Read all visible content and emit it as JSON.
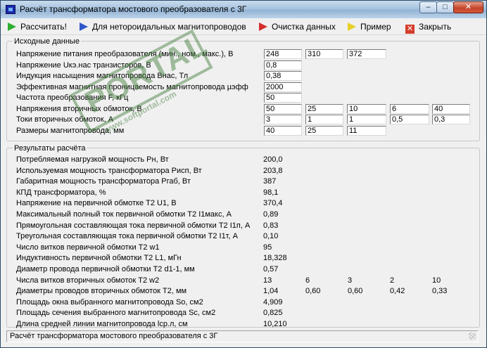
{
  "window": {
    "title": "Расчёт трансформатора мостового преобразователя с 3Г",
    "minimize_glyph": "–",
    "maximize_glyph": "□",
    "close_glyph": "✕"
  },
  "menu": [
    {
      "label": "Рассчитать!",
      "icon": "green-arrow-icon"
    },
    {
      "label": "Для нетороидальных магнитопроводов",
      "icon": "blue-arrow-icon"
    },
    {
      "label": "Очистка данных",
      "icon": "red-arrow-icon"
    },
    {
      "label": "Пример",
      "icon": "yellow-arrow-icon"
    },
    {
      "label": "Закрыть",
      "icon": "close-x-icon"
    }
  ],
  "input_group": {
    "title": "Исходные данные",
    "rows": [
      {
        "label": "Напряжение питания преобразователя (мин., ном., макс.), В",
        "values": [
          "248",
          "310",
          "372"
        ]
      },
      {
        "label": "Напряжение Uкэ.нас транзисторов, В",
        "values": [
          "0,8"
        ]
      },
      {
        "label": "Индукция насыщения магнитопровода Bнас, Тл",
        "values": [
          "0,38"
        ]
      },
      {
        "label": "Эффективная магнитная проницаемость магнитопровода µэфф",
        "values": [
          "2000"
        ]
      },
      {
        "label": "Частота преобразования F, кГц",
        "values": [
          "50"
        ]
      },
      {
        "label": "Напряжения вторичных обмоток, В",
        "values": [
          "50",
          "25",
          "10",
          "6",
          "40"
        ]
      },
      {
        "label": "Токи вторичных обмоток, А",
        "values": [
          "3",
          "1",
          "1",
          "0,5",
          "0,3"
        ]
      },
      {
        "label": "Размеры магнитопровода, мм",
        "values": [
          "40",
          "25",
          "11"
        ]
      }
    ]
  },
  "results_group": {
    "title": "Результаты расчёта",
    "rows": [
      {
        "label": "Потребляемая нагрузкой мощность Рн, Вт",
        "values": [
          "200,0"
        ]
      },
      {
        "label": "Используемая мощность трансформатора Рисп, Вт",
        "values": [
          "203,8"
        ]
      },
      {
        "label": "Габаритная мощность трансформатора Ргаб, Вт",
        "values": [
          "387"
        ]
      },
      {
        "label": "КПД трансформатора, %",
        "values": [
          "98,1"
        ]
      },
      {
        "label": "Напряжение на первичной обмотке Т2 U1, В",
        "values": [
          "370,4"
        ]
      },
      {
        "label": "Максимальный полный ток первичной обмотки Т2 I1макс, А",
        "values": [
          "0,89"
        ]
      },
      {
        "label": "Прямоугольная составляющая тока первичной обмотки Т2 I1п, А",
        "values": [
          "0,83"
        ]
      },
      {
        "label": "Треугольная составляющая тока первичной обмотки Т2 I1т, А",
        "values": [
          "0,10"
        ]
      },
      {
        "label": "Число витков первичной обмотки Т2 w1",
        "values": [
          "95"
        ]
      },
      {
        "label": "Индуктивность первичной обмотки Т2 L1, мГн",
        "values": [
          "18,328"
        ]
      },
      {
        "label": "Диаметр провода первичной обмотки Т2 d1-1, мм",
        "values": [
          "0,57"
        ]
      },
      {
        "label": "Числа витков вторичных обмоток Т2 w2",
        "values": [
          "13",
          "6",
          "3",
          "2",
          "10"
        ]
      },
      {
        "label": "Диаметры проводов вторичных обмоток Т2, мм",
        "values": [
          "1,04",
          "0,60",
          "0,60",
          "0,42",
          "0,33"
        ]
      },
      {
        "label": "Площадь окна выбранного магнитопровода So, см2",
        "values": [
          "4,909"
        ]
      },
      {
        "label": "Площадь сечения выбранного магнитопровода Sc, см2",
        "values": [
          "0,825"
        ]
      },
      {
        "label": "Длина средней линии магнитопровода lср.л, см",
        "values": [
          "10,210"
        ]
      }
    ]
  },
  "status": "Расчёт трансформатора мостового преобразователя с 3Г",
  "watermark": {
    "text": "PORTAL",
    "url": "www.softportal.com"
  }
}
